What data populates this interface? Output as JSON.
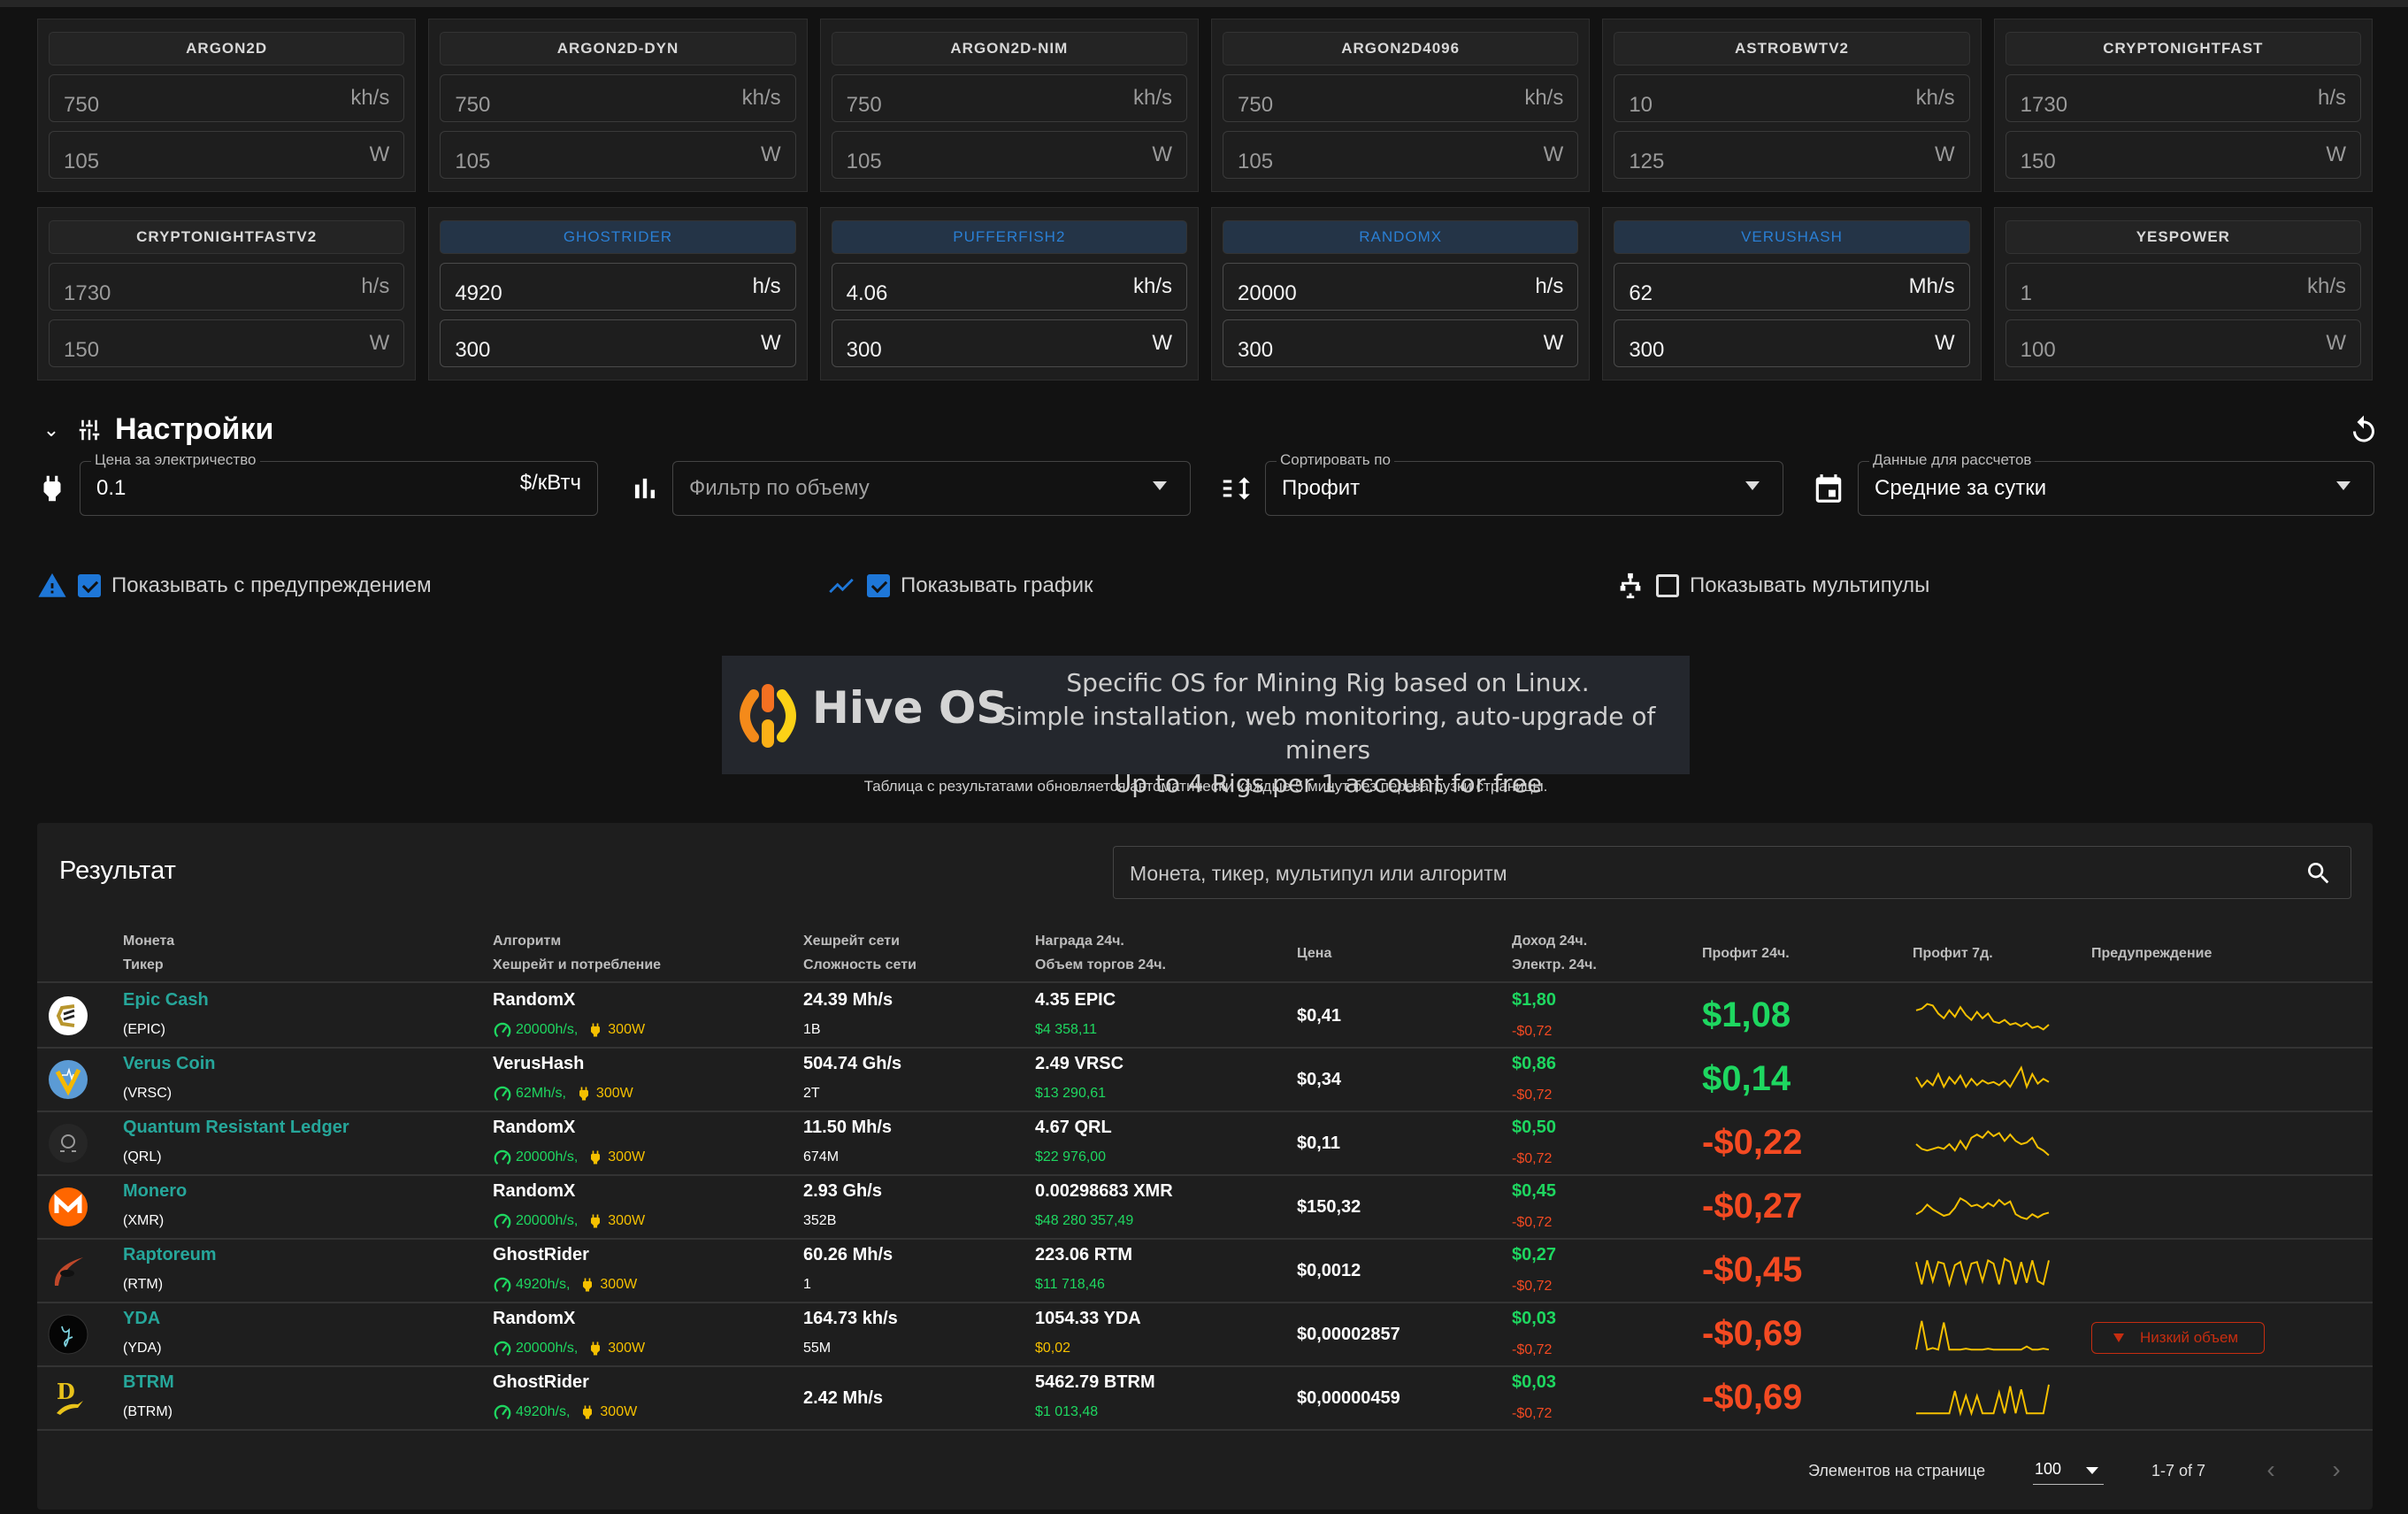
{
  "algorithms": [
    {
      "name": "ARGON2D",
      "hashrate": "750",
      "unit": "kh/s",
      "power": "105",
      "power_unit": "W",
      "active": false
    },
    {
      "name": "ARGON2D-DYN",
      "hashrate": "750",
      "unit": "kh/s",
      "power": "105",
      "power_unit": "W",
      "active": false
    },
    {
      "name": "ARGON2D-NIM",
      "hashrate": "750",
      "unit": "kh/s",
      "power": "105",
      "power_unit": "W",
      "active": false
    },
    {
      "name": "ARGON2D4096",
      "hashrate": "750",
      "unit": "kh/s",
      "power": "105",
      "power_unit": "W",
      "active": false
    },
    {
      "name": "ASTROBWTV2",
      "hashrate": "10",
      "unit": "kh/s",
      "power": "125",
      "power_unit": "W",
      "active": false
    },
    {
      "name": "CRYPTONIGHTFAST",
      "hashrate": "1730",
      "unit": "h/s",
      "power": "150",
      "power_unit": "W",
      "active": false
    },
    {
      "name": "CRYPTONIGHTFASTV2",
      "hashrate": "1730",
      "unit": "h/s",
      "power": "150",
      "power_unit": "W",
      "active": false
    },
    {
      "name": "GHOSTRIDER",
      "hashrate": "4920",
      "unit": "h/s",
      "power": "300",
      "power_unit": "W",
      "active": true
    },
    {
      "name": "PUFFERFISH2",
      "hashrate": "4.06",
      "unit": "kh/s",
      "power": "300",
      "power_unit": "W",
      "active": true
    },
    {
      "name": "RANDOMX",
      "hashrate": "20000",
      "unit": "h/s",
      "power": "300",
      "power_unit": "W",
      "active": true
    },
    {
      "name": "VERUSHASH",
      "hashrate": "62",
      "unit": "Mh/s",
      "power": "300",
      "power_unit": "W",
      "active": true
    },
    {
      "name": "YESPOWER",
      "hashrate": "1",
      "unit": "kh/s",
      "power": "100",
      "power_unit": "W",
      "active": false
    }
  ],
  "settings": {
    "title": "Настройки",
    "electricity": {
      "label": "Цена за электричество",
      "value": "0.1",
      "suffix": "$/кВтч"
    },
    "volume_filter": {
      "placeholder": "Фильтр по объему"
    },
    "sort_by": {
      "label": "Сортировать по",
      "value": "Профит"
    },
    "calc_data": {
      "label": "Данные для рассчетов",
      "value": "Средние за сутки"
    },
    "checkboxes": [
      {
        "label": "Показывать с предупреждением",
        "checked": true
      },
      {
        "label": "Показывать график",
        "checked": true
      },
      {
        "label": "Показывать мультипулы",
        "checked": false
      }
    ]
  },
  "banner": {
    "brand": "Hive OS",
    "lines": [
      "Specific OS for Mining Rig based on Linux.",
      "Simple installation, web monitoring, auto-upgrade of miners",
      "Up to 4 Rigs per 1 account for free"
    ]
  },
  "update_note": "Таблица с результатами обновляется автоматически каждые 5 минут без перезагрузки страницы.",
  "results": {
    "title": "Результат",
    "search_placeholder": "Монета, тикер, мультипул или алгоритм",
    "headers": {
      "coin": "Монета",
      "ticker": "Тикер",
      "algo": "Алгоритм",
      "algo_sub": "Хешрейт и потребление",
      "nethash": "Хешрейт сети",
      "difficulty": "Сложность сети",
      "reward": "Награда 24ч.",
      "volume": "Объем торгов 24ч.",
      "price": "Цена",
      "income": "Доход 24ч.",
      "elec": "Электр. 24ч.",
      "profit24": "Профит 24ч.",
      "profit7": "Профит 7д.",
      "warning": "Предупреждение"
    },
    "rows": [
      {
        "name": "Epic Cash",
        "ticker": "(EPIC)",
        "icon": "epic-cash-icon",
        "algo": "RandomX",
        "hashrate": "20000h/s,",
        "power": "300W",
        "nethash": "24.39 Mh/s",
        "difficulty": "1B",
        "reward": "4.35 EPIC",
        "volume": "$4 358,11",
        "volume_low": false,
        "price": "$0,41",
        "income": "$1,80",
        "elec": "-$0,72",
        "profit": "$1,08",
        "profit_positive": true,
        "warning": "",
        "spark": [
          0.7,
          0.75,
          0.9,
          0.85,
          0.6,
          0.45,
          0.7,
          0.5,
          0.8,
          0.55,
          0.4,
          0.65,
          0.45,
          0.6,
          0.35,
          0.3,
          0.4,
          0.25,
          0.3,
          0.2,
          0.3,
          0.15,
          0.2,
          0.1,
          0.25
        ]
      },
      {
        "name": "Verus Coin",
        "ticker": "(VRSC)",
        "icon": "verus-coin-icon",
        "algo": "VerusHash",
        "hashrate": "62Mh/s,",
        "power": "300W",
        "nethash": "504.74 Gh/s",
        "difficulty": "2T",
        "reward": "2.49 VRSC",
        "volume": "$13 290,61",
        "volume_low": false,
        "price": "$0,34",
        "income": "$0,86",
        "elec": "-$0,72",
        "profit": "$0,14",
        "profit_positive": true,
        "warning": "",
        "spark": [
          0.6,
          0.3,
          0.5,
          0.35,
          0.7,
          0.3,
          0.6,
          0.4,
          0.65,
          0.3,
          0.55,
          0.35,
          0.5,
          0.4,
          0.45,
          0.35,
          0.5,
          0.3,
          0.6,
          0.9,
          0.3,
          0.7,
          0.4,
          0.55,
          0.45
        ]
      },
      {
        "name": "Quantum Resistant Ledger",
        "ticker": "(QRL)",
        "icon": "qrl-icon",
        "algo": "RandomX",
        "hashrate": "20000h/s,",
        "power": "300W",
        "nethash": "11.50 Mh/s",
        "difficulty": "674M",
        "reward": "4.67 QRL",
        "volume": "$22 976,00",
        "volume_low": false,
        "price": "$0,11",
        "income": "$0,50",
        "elec": "-$0,72",
        "profit": "-$0,22",
        "profit_positive": false,
        "warning": "",
        "spark": [
          0.5,
          0.35,
          0.3,
          0.35,
          0.4,
          0.35,
          0.5,
          0.3,
          0.6,
          0.35,
          0.7,
          0.8,
          0.7,
          0.9,
          0.75,
          0.85,
          0.6,
          0.8,
          0.6,
          0.5,
          0.55,
          0.7,
          0.4,
          0.3,
          0.15
        ]
      },
      {
        "name": "Monero",
        "ticker": "(XMR)",
        "icon": "monero-icon",
        "algo": "RandomX",
        "hashrate": "20000h/s,",
        "power": "300W",
        "nethash": "2.93 Gh/s",
        "difficulty": "352B",
        "reward": "0.00298683 XMR",
        "volume": "$48 280 357,49",
        "volume_low": false,
        "price": "$150,32",
        "income": "$0,45",
        "elec": "-$0,72",
        "profit": "-$0,27",
        "profit_positive": false,
        "warning": "",
        "spark": [
          0.3,
          0.4,
          0.6,
          0.45,
          0.35,
          0.25,
          0.3,
          0.5,
          0.8,
          0.7,
          0.55,
          0.6,
          0.5,
          0.65,
          0.55,
          0.75,
          0.6,
          0.7,
          0.3,
          0.2,
          0.15,
          0.3,
          0.2,
          0.3,
          0.35
        ]
      },
      {
        "name": "Raptoreum",
        "ticker": "(RTM)",
        "icon": "raptoreum-icon",
        "algo": "GhostRider",
        "hashrate": "4920h/s,",
        "power": "300W",
        "nethash": "60.26 Mh/s",
        "difficulty": "1",
        "reward": "223.06 RTM",
        "volume": "$11 718,46",
        "volume_low": false,
        "price": "$0,0012",
        "income": "$0,27",
        "elec": "-$0,72",
        "profit": "-$0,45",
        "profit_positive": false,
        "warning": "",
        "spark": [
          0.8,
          0.1,
          0.85,
          0.2,
          0.8,
          0.75,
          0.1,
          0.7,
          0.8,
          0.15,
          0.75,
          0.8,
          0.2,
          0.85,
          0.75,
          0.1,
          0.9,
          0.8,
          0.1,
          0.8,
          0.15,
          0.85,
          0.2,
          0.1,
          0.85
        ]
      },
      {
        "name": "YDA",
        "ticker": "(YDA)",
        "icon": "yda-icon",
        "algo": "RandomX",
        "hashrate": "20000h/s,",
        "power": "300W",
        "nethash": "164.73 kh/s",
        "difficulty": "55M",
        "reward": "1054.33 YDA",
        "volume": "$0,02",
        "volume_low": true,
        "price": "$0,00002857",
        "income": "$0,03",
        "elec": "-$0,72",
        "profit": "-$0,69",
        "profit_positive": false,
        "warning": "Низкий объем",
        "spark": [
          0.05,
          0.95,
          0.05,
          0.1,
          0.05,
          0.9,
          0.05,
          0.05,
          0.05,
          0.08,
          0.05,
          0.05,
          0.05,
          0.08,
          0.05,
          0.05,
          0.05,
          0.05,
          0.05,
          0.05,
          0.15,
          0.05,
          0.05,
          0.08,
          0.05
        ]
      },
      {
        "name": "BTRM",
        "ticker": "(BTRM)",
        "icon": "btrm-icon",
        "algo": "GhostRider",
        "hashrate": "4920h/s,",
        "power": "300W",
        "nethash": "2.42 Mh/s",
        "difficulty": "",
        "reward": "5462.79 BTRM",
        "volume": "$1 013,48",
        "volume_low": false,
        "price": "$0,00000459",
        "income": "$0,03",
        "elec": "-$0,72",
        "profit": "-$0,69",
        "profit_positive": false,
        "warning": "",
        "spark": [
          0.05,
          0.05,
          0.05,
          0.05,
          0.05,
          0.05,
          0.05,
          0.75,
          0.05,
          0.6,
          0.05,
          0.6,
          0.05,
          0.05,
          0.05,
          0.7,
          0.05,
          0.9,
          0.05,
          0.8,
          0.05,
          0.05,
          0.05,
          0.05,
          0.95
        ]
      }
    ],
    "pagination": {
      "per_page_label": "Элементов на странице",
      "per_page": "100",
      "range": "1-7 of 7"
    }
  },
  "colors": {
    "accent": "#1e77d8",
    "positive": "#1ed760",
    "negative": "#f44a22",
    "coin_link": "#26a69a",
    "spark": "#f5c000"
  }
}
